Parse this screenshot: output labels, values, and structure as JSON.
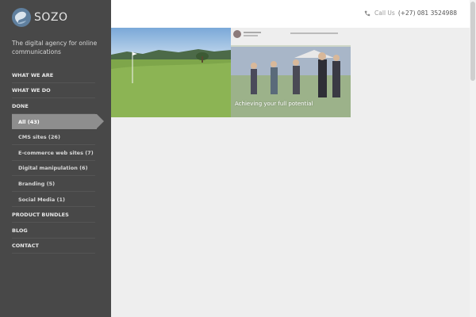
{
  "brand": {
    "name": "SOZO",
    "tagline": "The digital agency for online communications"
  },
  "header": {
    "call_label": "Call Us",
    "phone": "(+27) 081 3524988"
  },
  "nav": {
    "top_items": [
      "WHAT WE ARE",
      "WHAT WE DO",
      "DONE"
    ],
    "sub_items": [
      {
        "label": "All (43)",
        "active": true
      },
      {
        "label": "CMS sites (26)"
      },
      {
        "label": "E-commerce web sites (7)"
      },
      {
        "label": "Digital manipulation (6)"
      },
      {
        "label": "Branding (5)"
      },
      {
        "label": "Social Media (1)"
      }
    ],
    "bottom_items": [
      "PRODUCT BUNDLES",
      "BLOG",
      "CONTACT"
    ]
  },
  "portfolio": {
    "items": [
      {
        "icon": "golf-course-image"
      },
      {
        "icon": "school-website-image",
        "caption": "Achieving your full potential"
      }
    ]
  },
  "colors": {
    "sidebar": "#484848",
    "active": "#8e8e8e",
    "content_bg": "#eeeeee"
  }
}
